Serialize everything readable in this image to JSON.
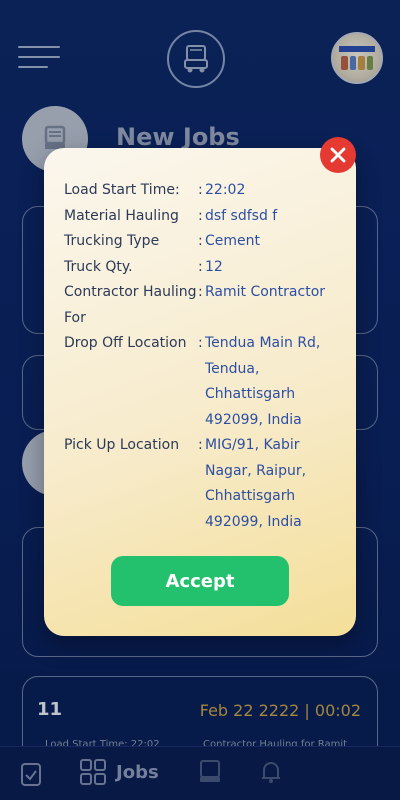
{
  "header": {
    "menu_icon": "hamburger-icon",
    "logo_icon": "truck-icon",
    "avatar_icon": "profile-avatar"
  },
  "section": {
    "title": "New Jobs"
  },
  "cards": [
    {
      "number": "11",
      "date": "Feb 22 2222 | 00:02",
      "left_label": "Load Start Time: 22:02",
      "right_label": "Contractor Hauling for Ramit"
    }
  ],
  "modal": {
    "rows": [
      {
        "label": "Load Start Time:",
        "value": "22:02"
      },
      {
        "label": "Material Hauling",
        "value": "dsf sdfsd f"
      },
      {
        "label": "Trucking Type",
        "value": "Cement"
      },
      {
        "label": "Truck Qty.",
        "value": "12"
      },
      {
        "label": "Contractor Hauling For",
        "value": "Ramit Contractor"
      },
      {
        "label": "Drop Off Location",
        "value": "Tendua Main Rd, Tendua, Chhattisgarh 492099, India"
      },
      {
        "label": "Pick Up Location",
        "value": "MIG/91, Kabir Nagar, Raipur, Chhattisgarh 492099, India"
      }
    ],
    "accept_label": "Accept",
    "close_icon": "close-icon"
  },
  "bottom_nav": {
    "jobs_label": "Jobs"
  },
  "colors": {
    "background": "#0b2566",
    "modal_accent": "#f4df99",
    "accept": "#23c16d",
    "close": "#e53a32",
    "value_text": "#2d4fa3"
  }
}
